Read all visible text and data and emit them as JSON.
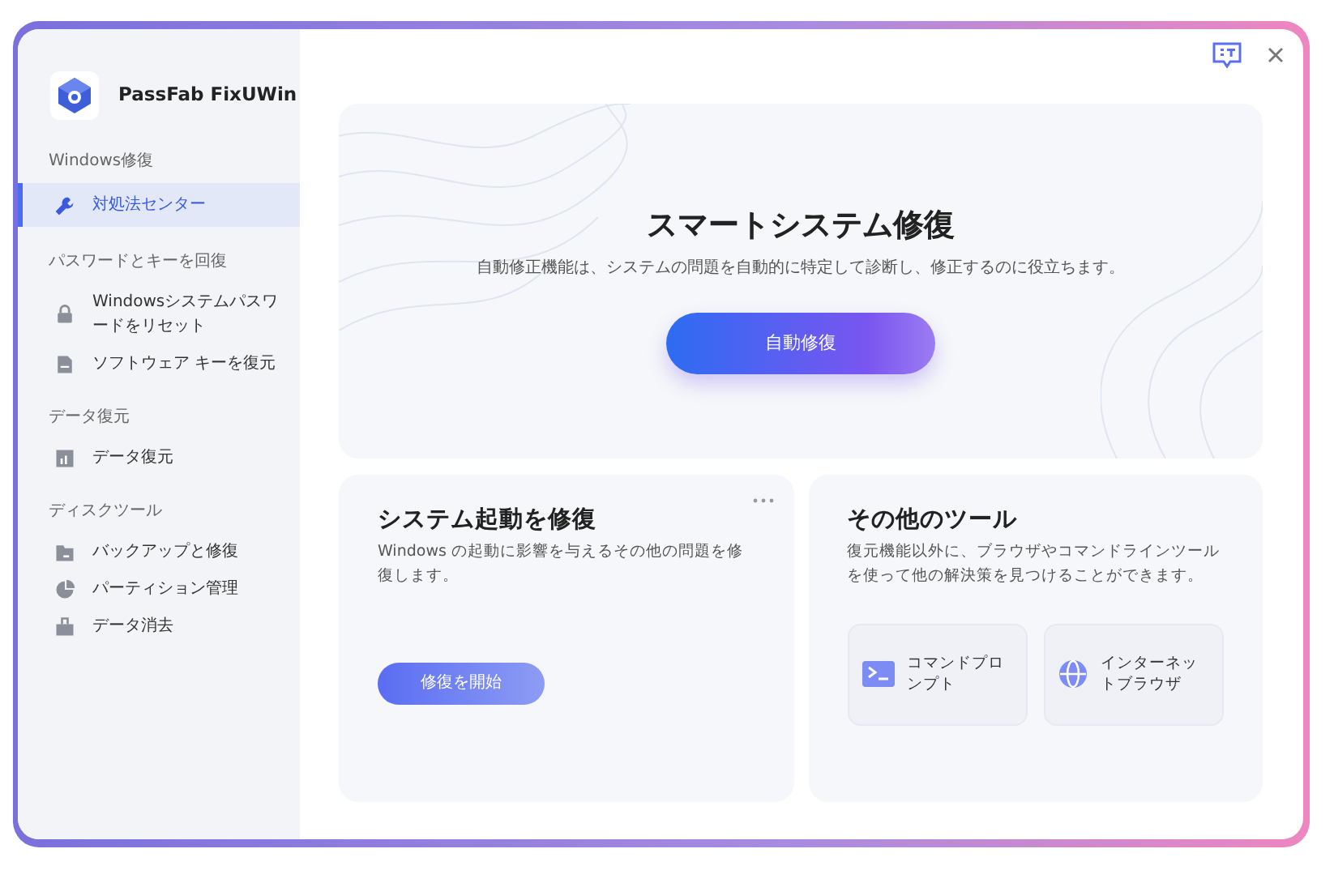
{
  "app": {
    "name": "PassFab FixUWin"
  },
  "sidebar": {
    "sections": [
      {
        "heading": "Windows修復",
        "items": [
          {
            "label": "対処法センター",
            "selected": true
          }
        ]
      },
      {
        "heading": "パスワードとキーを回復",
        "items": [
          {
            "label": "Windowsシステムパスワードをリセット",
            "selected": false
          },
          {
            "label": "ソフトウェア キーを復元",
            "selected": false
          }
        ]
      },
      {
        "heading": "データ復元",
        "items": [
          {
            "label": "データ復元",
            "selected": false
          }
        ]
      },
      {
        "heading": "ディスクツール",
        "items": [
          {
            "label": "バックアップと修復",
            "selected": false
          },
          {
            "label": "パーティション管理",
            "selected": false
          },
          {
            "label": "データ消去",
            "selected": false
          }
        ]
      }
    ]
  },
  "smart_repair": {
    "title": "スマートシステム修復",
    "description": "自動修正機能は、システムの問題を自動的に特定して診断し、修正するのに役立ちます。",
    "button": "自動修復"
  },
  "boot_repair": {
    "title": "システム起動を修復",
    "description": "Windows の起動に影響を与えるその他の問題を修復します。",
    "button": "修復を開始"
  },
  "other_tools": {
    "title": "その他のツール",
    "description": "復元機能以外に、ブラウザやコマンドラインツールを使って他の解決策を見つけることができます。",
    "tools": [
      {
        "label": "コマンドプロンプト"
      },
      {
        "label": "インターネットブラウザ"
      }
    ]
  }
}
